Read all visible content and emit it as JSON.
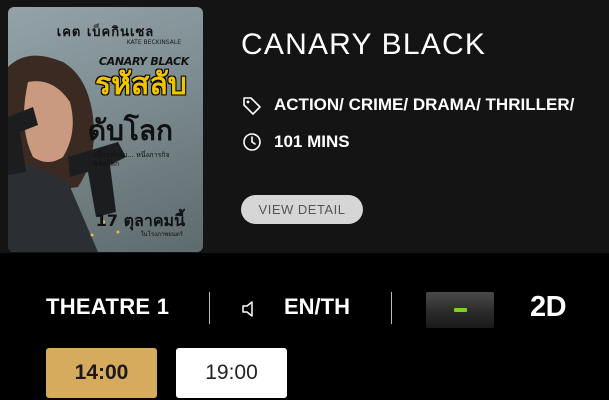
{
  "movie": {
    "title": "CANARY BLACK",
    "genres": "ACTION/ CRIME/ DRAMA/ THRILLER/",
    "duration": "101 MINS",
    "detail_button": "VIEW DETAIL",
    "genre_icon": "tag-icon",
    "duration_icon": "clock-icon"
  },
  "poster": {
    "top_credit": "เคต เบ็คกินเซล",
    "small_credit": "KATE BECKINSALE",
    "brand": "CANARY BLACK",
    "thai_title_line1": "รหัสลับ",
    "thai_title_line2": "ดับโลก",
    "tagline": "หนึ่งรหัสลับ... หนึ่งภารกิจพิชิตโลก",
    "release_date": "17 ตุลาคมนี้",
    "release_sub": "ในโรงภาพยนตร์"
  },
  "showtime": {
    "theatre": "THEATRE 1",
    "audio_icon": "speaker-icon",
    "audio_language": "EN/TH",
    "rating_indicator_color": "#7ed321",
    "format": "2D",
    "times": [
      {
        "label": "14:00",
        "selected": true
      },
      {
        "label": "19:00",
        "selected": false
      }
    ]
  },
  "colors": {
    "selected_time_bg": "#d6ab5d",
    "card_bg": "#141414"
  }
}
